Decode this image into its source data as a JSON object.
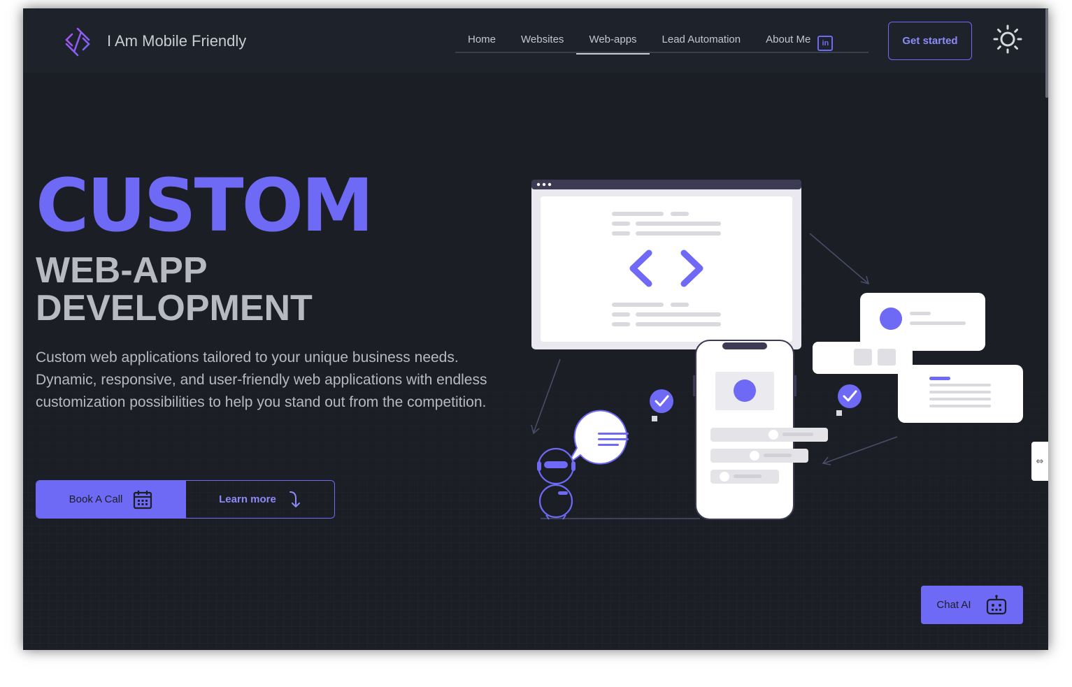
{
  "header": {
    "brand": "I Am Mobile Friendly",
    "logo_icon": "code-diamond-icon",
    "nav": [
      {
        "label": "Home",
        "active": false
      },
      {
        "label": "Websites",
        "active": false
      },
      {
        "label": "Web-apps",
        "active": true
      },
      {
        "label": "Lead Automation",
        "active": false
      },
      {
        "label": "About Me",
        "active": false
      }
    ],
    "linkedin_text": "in",
    "cta_label": "Get started",
    "theme_icon": "sun-icon"
  },
  "hero": {
    "title": "CUSTOM",
    "subtitle_line1": "WEB-APP",
    "subtitle_line2": "DEVELOPMENT",
    "description": "Custom web applications tailored to your unique business needs. Dynamic, responsive, and user-friendly web applications with endless customization possibilities to help you stand out from the competition.",
    "book_label": "Book A Call",
    "book_icon": "calendar-icon",
    "learn_label": "Learn more",
    "learn_icon": "arrow-down-curve-icon"
  },
  "side_tab": {
    "icon": "expand-icon"
  },
  "chat": {
    "label": "Chat AI",
    "icon": "robot-icon"
  },
  "colors": {
    "accent": "#6e6af5",
    "background": "#1b1e25",
    "header_bg": "#1e222a",
    "text_muted": "#b7bac1"
  }
}
